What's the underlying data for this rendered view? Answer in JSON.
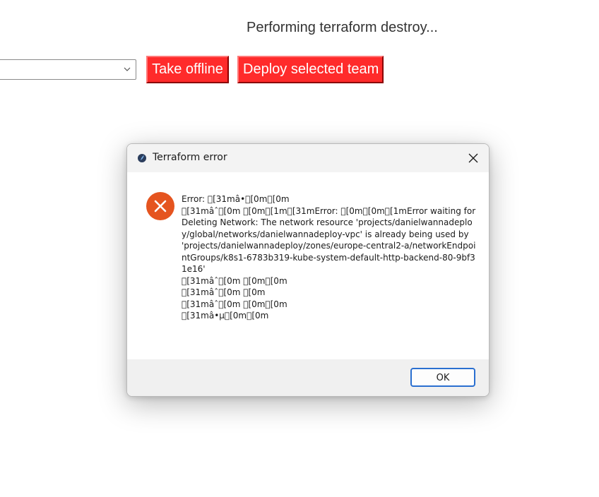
{
  "page": {
    "status_text": "Performing terraform destroy..."
  },
  "controls": {
    "team_select_value": "",
    "take_offline_label": "Take offline",
    "deploy_label": "Deploy selected team",
    "button_color": "#ff2b2b"
  },
  "dialog": {
    "title": "Terraform error",
    "icon": "error-icon",
    "message": "Error: \u0000[31mâ•\u0000[0m\u0000[0m\n\u0000[31mâˆ\u0000[0m \u0000[0m\u0000[1m\u0000[31mError: \u0000[0m\u0000[0m\u0000[1mError waiting for Deleting Network: The network resource 'projects/danielwannadeploy/global/networks/danielwannadeploy-vpc' is already being used by 'projects/danielwannadeploy/zones/europe-central2-a/networkEndpointGroups/k8s1-6783b319-kube-system-default-http-backend-80-9bf31e16'\n\u0000[31mâˆ\u0000[0m \u0000[0m\u0000[0m\n\u0000[31mâˆ\u0000[0m \u0000[0m\n\u0000[31mâˆ\u0000[0m \u0000[0m\u0000[0m\n\u0000[31mâ•µ\u0000[0m\u0000[0m",
    "ok_label": "OK",
    "error_color": "#e5541f"
  }
}
